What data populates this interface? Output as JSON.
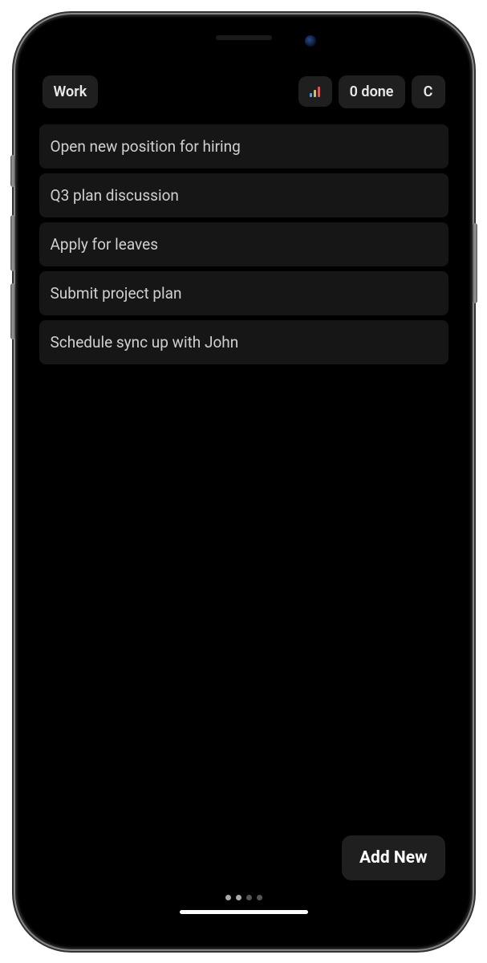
{
  "header": {
    "list_name": "Work",
    "done_count": "0 done",
    "clear_label": "C"
  },
  "tasks": [
    {
      "title": "Open new position for hiring"
    },
    {
      "title": "Q3 plan discussion"
    },
    {
      "title": "Apply for leaves"
    },
    {
      "title": "Submit project plan"
    },
    {
      "title": "Schedule sync up with John"
    }
  ],
  "footer": {
    "add_button": "Add New",
    "page_dots_total": 4,
    "page_dots_active": 2
  },
  "colors": {
    "background": "#000000",
    "card_bg": "#161616",
    "button_bg": "#1f1f1f",
    "text": "#d0d0d0"
  }
}
